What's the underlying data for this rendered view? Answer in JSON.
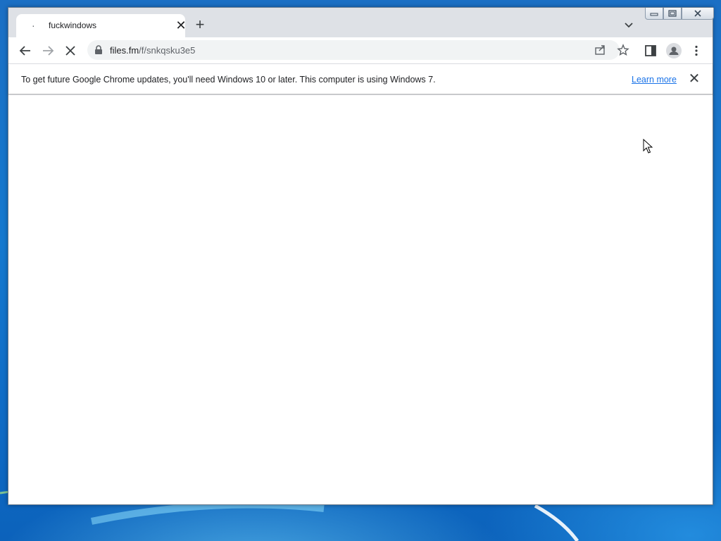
{
  "tab": {
    "title": "fuckwindows",
    "favicon": "·"
  },
  "address_bar": {
    "host": "files.fm",
    "path": "/f/snkqsku3e5"
  },
  "infobar": {
    "message": "To get future Google Chrome updates, you'll need Windows 10 or later. This computer is using Windows 7.",
    "learn_more": "Learn more"
  },
  "glyphs": {
    "close": "✕",
    "new_tab": "+",
    "minimize": "▭",
    "restore": "❐",
    "window_close": "✕"
  },
  "colors": {
    "accent": "#1a73e8",
    "tabstrip": "#dee1e6",
    "desktop": "#1677c9"
  }
}
